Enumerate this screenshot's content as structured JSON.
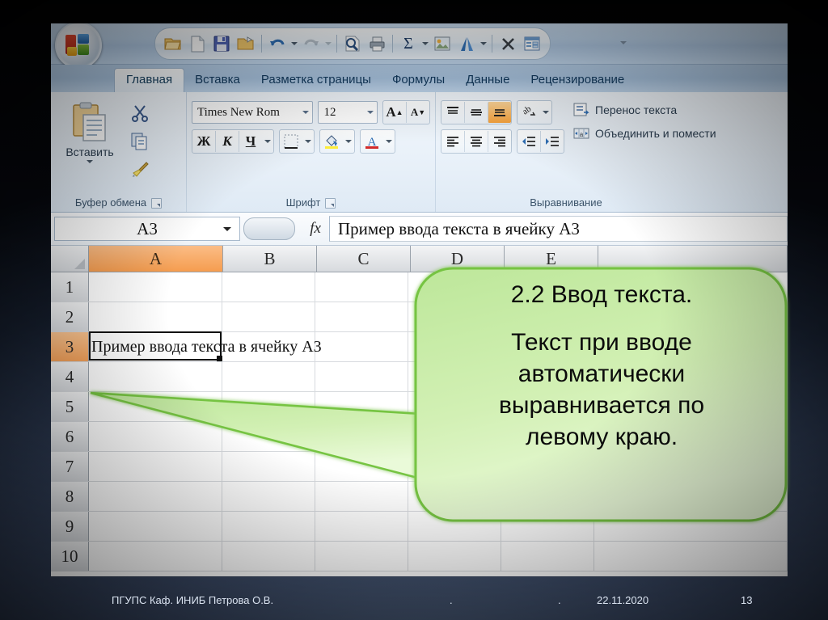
{
  "window": {
    "quick_access": [
      {
        "name": "open-icon",
        "label": "Открыть"
      },
      {
        "name": "new-document-icon",
        "label": "Создать"
      },
      {
        "name": "save-icon",
        "label": "Сохранить"
      },
      {
        "name": "save-as-icon",
        "label": "Сохранить как"
      },
      {
        "name": "undo-icon",
        "label": "Отменить"
      },
      {
        "name": "redo-icon",
        "label": "Вернуть"
      },
      {
        "name": "print-preview-icon",
        "label": "Предварительный просмотр"
      },
      {
        "name": "print-icon",
        "label": "Печать"
      },
      {
        "name": "autosum-icon",
        "label": "Сумма"
      },
      {
        "name": "insert-picture-icon",
        "label": "Рисунок"
      },
      {
        "name": "wordart-icon",
        "label": "WordArt"
      },
      {
        "name": "close-icon",
        "label": "Закрыть"
      },
      {
        "name": "form-icon",
        "label": "Форма"
      }
    ],
    "quick_access_more": "customize-quick-access-icon"
  },
  "tabs": [
    {
      "label": "Главная",
      "active": true
    },
    {
      "label": "Вставка",
      "active": false
    },
    {
      "label": "Разметка страницы",
      "active": false
    },
    {
      "label": "Формулы",
      "active": false
    },
    {
      "label": "Данные",
      "active": false
    },
    {
      "label": "Рецензирование",
      "active": false
    }
  ],
  "ribbon": {
    "clipboard": {
      "title": "Буфер обмена",
      "paste_label": "Вставить",
      "cut_label": "Вырезать",
      "copy_label": "Копировать",
      "format_painter_label": "Формат по образцу"
    },
    "font": {
      "title": "Шрифт",
      "font_name": "Times New Rom",
      "font_size": "12",
      "grow_font": "A",
      "shrink_font": "A",
      "bold": "Ж",
      "italic": "К",
      "underline": "Ч",
      "borders_label": "Границы",
      "fill_color_label": "Цвет заливки",
      "font_color_label": "Цвет текста"
    },
    "alignment": {
      "title": "Выравнивание",
      "wrap_text": "Перенос текста",
      "merge_center": "Объединить и помести",
      "align_top": "По верхнему краю",
      "align_middle": "По середине",
      "align_bottom": "По нижнему краю",
      "orientation": "Ориентация",
      "align_left": "По левому краю",
      "align_center": "По центру",
      "align_right": "По правому краю",
      "decrease_indent": "Уменьшить отступ",
      "increase_indent": "Увеличить отступ"
    }
  },
  "formula_bar": {
    "name_box": "A3",
    "fx_label": "fx",
    "formula_value": "Пример ввода текста в ячейку A3"
  },
  "sheet": {
    "columns": [
      "A",
      "B",
      "C",
      "D",
      "E"
    ],
    "selected_column": "A",
    "rows": [
      "1",
      "2",
      "3",
      "4",
      "5",
      "6",
      "7",
      "8",
      "9",
      "10"
    ],
    "selected_row": "3",
    "active_cell": "A3",
    "active_cell_value": "Пример ввода текста в ячейку A3"
  },
  "callout": {
    "line1": "2.2  Ввод текста.",
    "line2": "Текст при вводе",
    "line3": "автоматически",
    "line4": "выравнивается по",
    "line5": "левому краю.",
    "fill_color": "#c9eca4",
    "border_color": "#76c442"
  },
  "footer": {
    "author": "ПГУПС  Каф. ИНИБ   Петрова О.В.",
    "dot1": ".",
    "dot2": ".",
    "date": "22.11.2020",
    "page": "13"
  }
}
